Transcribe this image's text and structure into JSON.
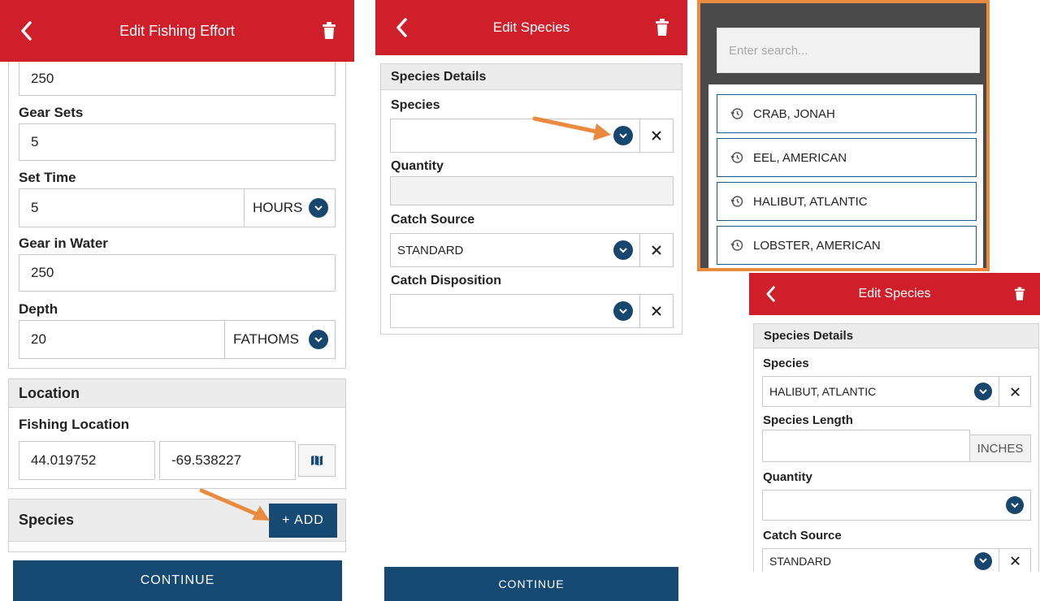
{
  "panel1": {
    "header_title": "Edit Fishing Effort",
    "top_value": "250",
    "gear_sets": {
      "label": "Gear Sets",
      "value": "5"
    },
    "set_time": {
      "label": "Set Time",
      "value": "5",
      "unit": "HOURS"
    },
    "gear_in_water": {
      "label": "Gear in Water",
      "value": "250"
    },
    "depth": {
      "label": "Depth",
      "value": "20",
      "unit": "FATHOMS"
    },
    "location": {
      "heading": "Location",
      "label": "Fishing Location",
      "latitude": "44.019752",
      "longitude": "-69.538227"
    },
    "species": {
      "heading": "Species",
      "add_label": "+ ADD"
    },
    "continue_label": "CONTINUE"
  },
  "panel2": {
    "header_title": "Edit Species",
    "section_heading": "Species Details",
    "species_label": "Species",
    "species_value": "",
    "quantity_label": "Quantity",
    "quantity_value": "",
    "catch_source_label": "Catch Source",
    "catch_source_value": "STANDARD",
    "catch_disposition_label": "Catch Disposition",
    "catch_disposition_value": "",
    "continue_label": "CONTINUE"
  },
  "panel3": {
    "search_placeholder": "Enter search...",
    "items": [
      "CRAB, JONAH",
      "EEL, AMERICAN",
      "HALIBUT, ATLANTIC",
      "LOBSTER, AMERICAN"
    ]
  },
  "panel4": {
    "header_title": "Edit Species",
    "section_heading": "Species Details",
    "species_label": "Species",
    "species_value": "HALIBUT, ATLANTIC",
    "species_length_label": "Species Length",
    "species_length_value": "",
    "species_length_unit": "INCHES",
    "quantity_label": "Quantity",
    "quantity_value": "",
    "catch_source_label": "Catch Source",
    "catch_source_value": "STANDARD"
  },
  "colors": {
    "header_red": "#cf1f2a",
    "primary_blue": "#164a72",
    "annotation_orange": "#e98a3f"
  }
}
